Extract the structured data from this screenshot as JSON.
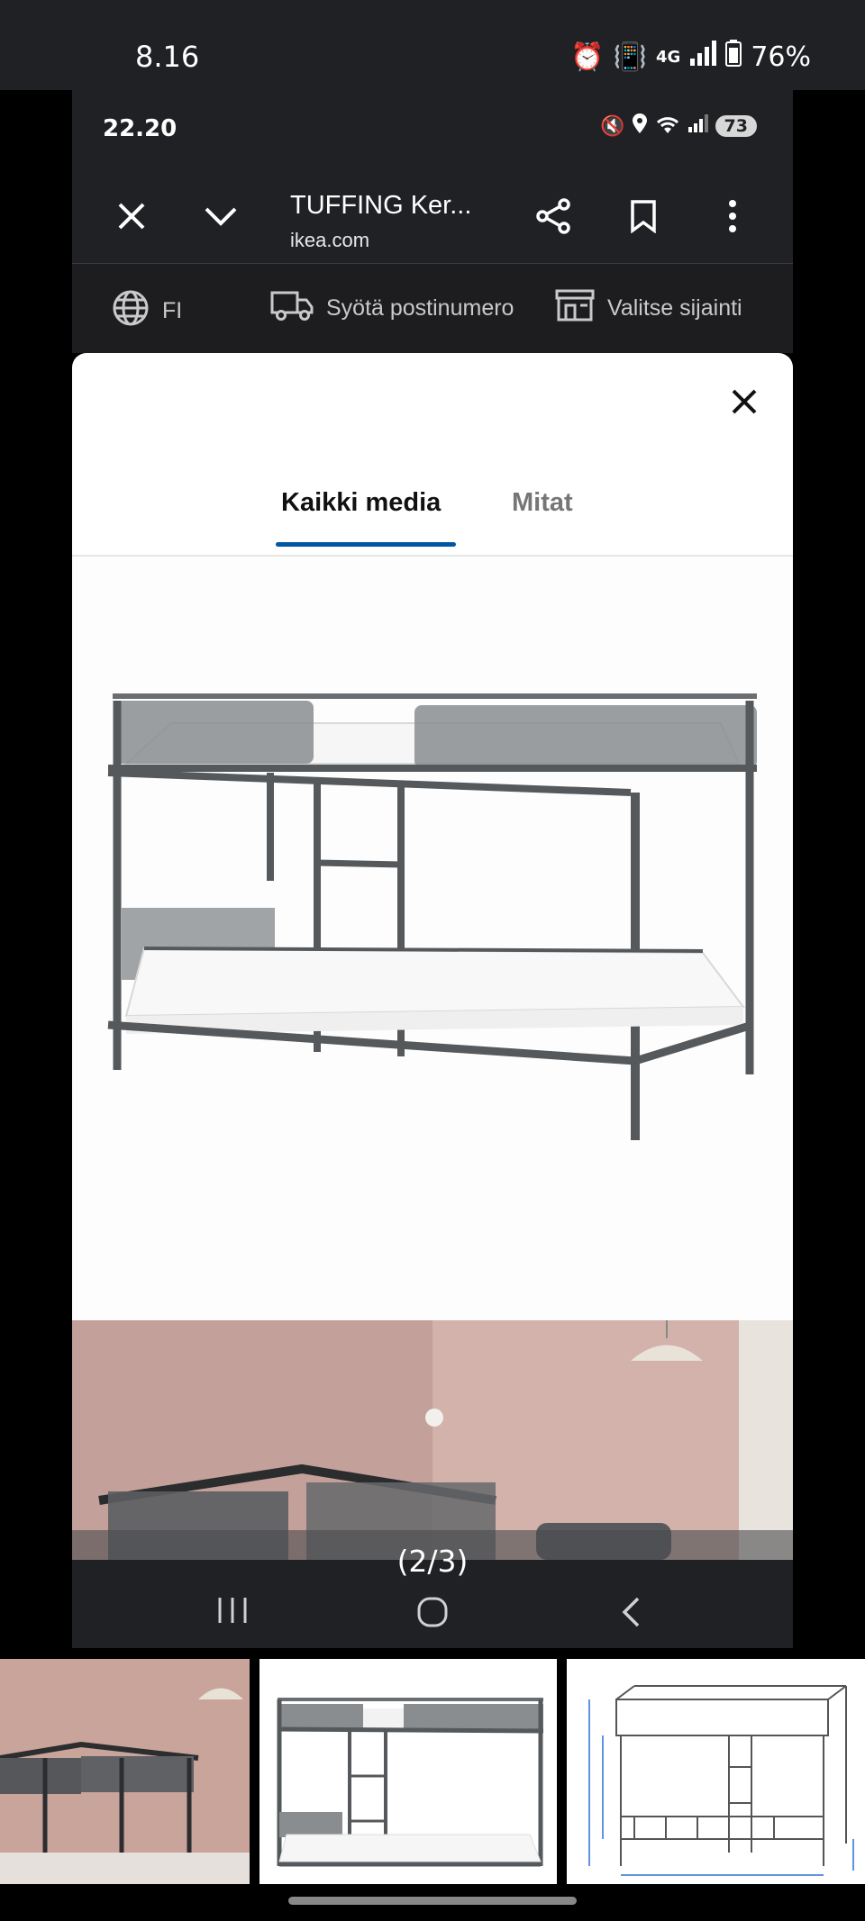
{
  "outer_status": {
    "time": "8.16",
    "network": "4G",
    "battery": "76%"
  },
  "inner_status": {
    "time": "22.20",
    "battery": "73"
  },
  "browser": {
    "title": "TUFFING Ker...",
    "domain": "ikea.com"
  },
  "ikea_bar": {
    "language": "FI",
    "postcode_label": "Syötä postinumero",
    "location_label": "Valitse sijainti"
  },
  "modal": {
    "tabs": [
      {
        "label": "Kaikki media",
        "active": true
      },
      {
        "label": "Mitat",
        "active": false
      }
    ],
    "counter": "(2/3)"
  },
  "colors": {
    "tab_active_underline": "#0058a3",
    "status_bar": "#202124",
    "bed_frame": "#55595c"
  },
  "icons": [
    "close-icon",
    "chevron-down-icon",
    "share-icon",
    "bookmark-icon",
    "more-vert-icon",
    "globe-icon",
    "truck-icon",
    "store-icon",
    "recents-icon",
    "home-icon",
    "back-icon"
  ]
}
